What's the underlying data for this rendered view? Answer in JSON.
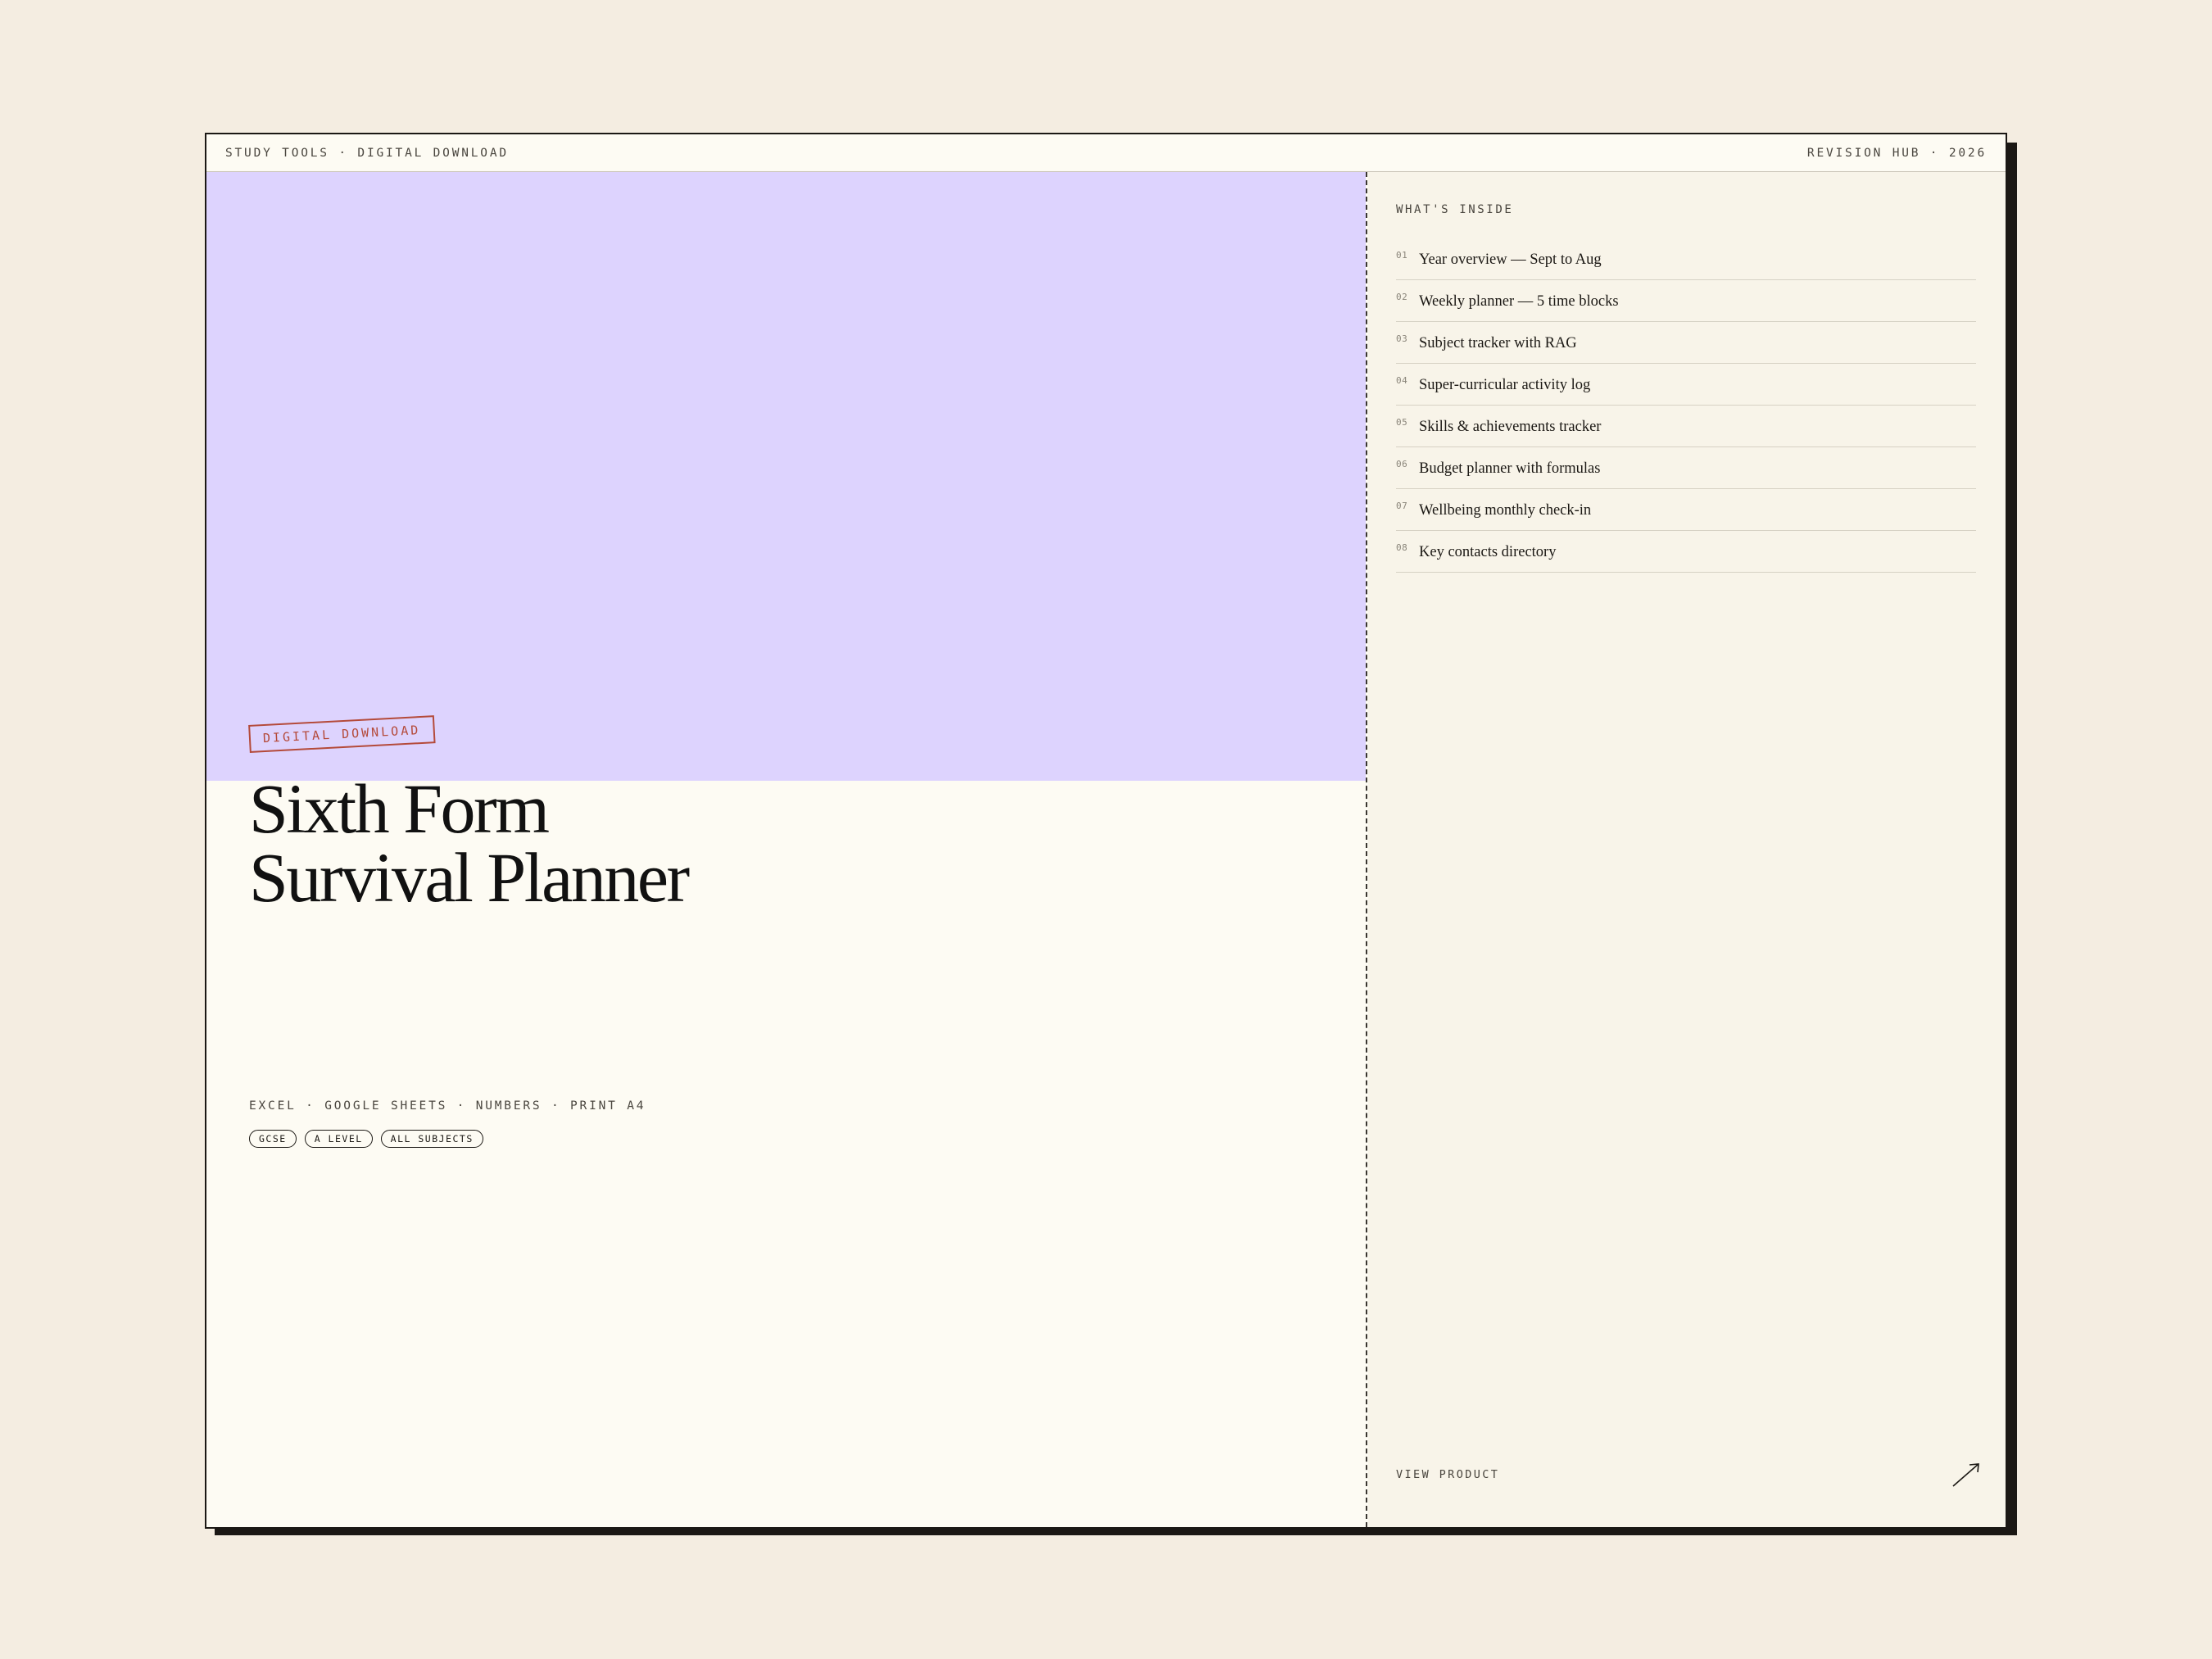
{
  "topbar": {
    "left": "STUDY TOOLS · DIGITAL DOWNLOAD",
    "right": "REVISION HUB · 2026"
  },
  "hero": {
    "accent_color": "#ddd3fe",
    "stamp": "DIGITAL DOWNLOAD",
    "stamp_color": "#b44a3a",
    "title_line1": "Sixth Form",
    "title_line2": "Survival Planner",
    "formats": "EXCEL · GOOGLE SHEETS · NUMBERS · PRINT A4",
    "tags": [
      "GCSE",
      "A LEVEL",
      "ALL SUBJECTS"
    ]
  },
  "contents": {
    "heading": "WHAT'S INSIDE",
    "items": [
      {
        "num": "01",
        "label": "Year overview — Sept to Aug"
      },
      {
        "num": "02",
        "label": "Weekly planner — 5 time blocks"
      },
      {
        "num": "03",
        "label": "Subject tracker with RAG"
      },
      {
        "num": "04",
        "label": "Super-curricular activity log"
      },
      {
        "num": "05",
        "label": "Skills & achievements tracker"
      },
      {
        "num": "06",
        "label": "Budget planner with formulas"
      },
      {
        "num": "07",
        "label": "Wellbeing monthly check-in"
      },
      {
        "num": "08",
        "label": "Key contacts directory"
      }
    ]
  },
  "cta": {
    "label": "VIEW PRODUCT",
    "icon": "arrow-up-right-icon"
  }
}
